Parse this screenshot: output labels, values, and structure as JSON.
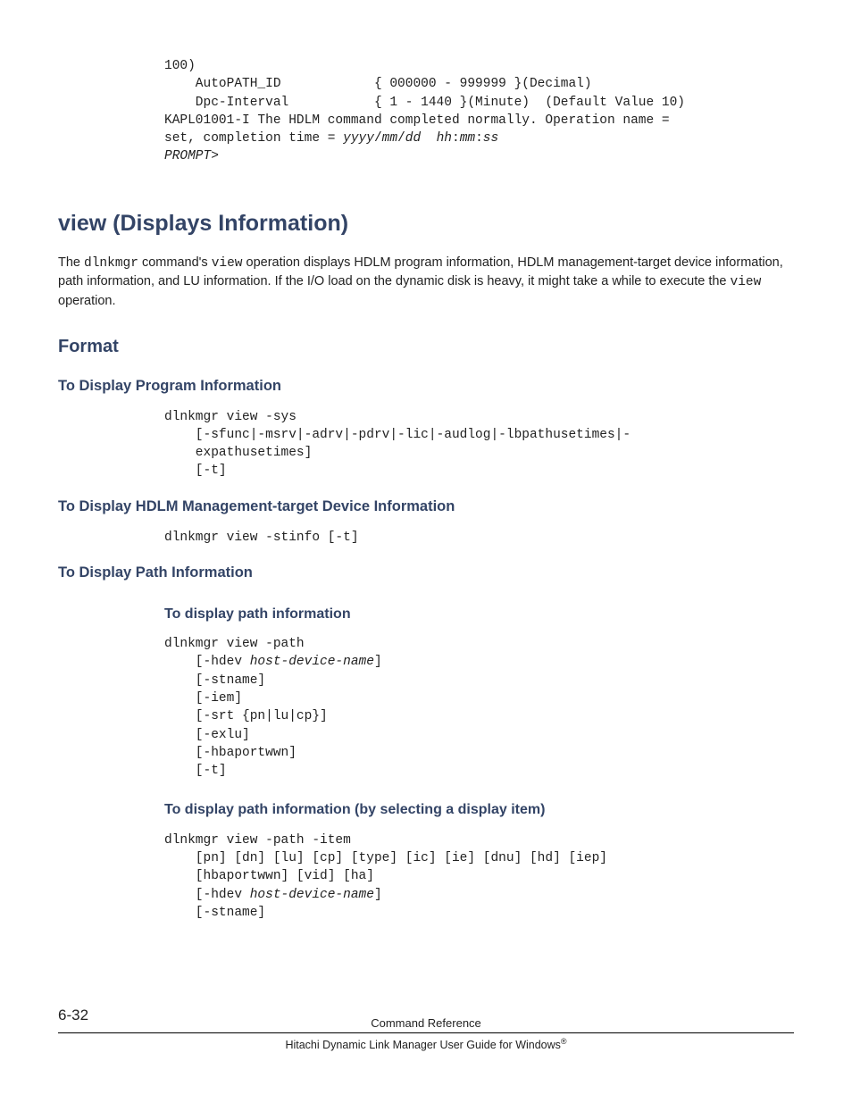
{
  "topcode": {
    "l1": "100)",
    "l2": "    AutoPATH_ID            { 000000 - 999999 }(Decimal)",
    "l3": "    Dpc-Interval           { 1 - 1440 }(Minute)  (Default Value 10)",
    "l4": "KAPL01001-I The HDLM command completed normally. Operation name = ",
    "l5": "set, completion time = ",
    "l5i": "yyyy",
    "l5s1": "/",
    "l5i2": "mm",
    "l5s2": "/",
    "l5i3": "dd",
    "l5sp": "  ",
    "l5i4": "hh",
    "l5s3": ":",
    "l5i5": "mm",
    "l5s4": ":",
    "l5i6": "ss",
    "l6": "PROMPT",
    "l6s": ">"
  },
  "h1": "view (Displays Information)",
  "intro": {
    "p1a": "The ",
    "p1b": "dlnkmgr",
    "p1c": " command's ",
    "p1d": "view",
    "p1e": " operation displays HDLM program information, HDLM management-target device information, path information, and LU information. If the I/O load on the dynamic disk is heavy, it might take a while to execute the ",
    "p1f": "view",
    "p1g": " operation."
  },
  "h2": "Format",
  "sec1": {
    "title": "To Display Program Information",
    "c1": "dlnkmgr view -sys",
    "c2": "    [-sfunc|-msrv|-adrv|-pdrv|-lic|-audlog|-lbpathusetimes|-",
    "c3": "    expathusetimes]",
    "c4": "    [-t]"
  },
  "sec2": {
    "title": "To Display HDLM Management-target Device Information",
    "c1": "dlnkmgr view -stinfo [-t]"
  },
  "sec3": {
    "title": "To Display Path Information",
    "sub1": {
      "title": "To display path information",
      "c1": "dlnkmgr view -path",
      "c2a": "    [-hdev ",
      "c2b": "host-device-name",
      "c2c": "]",
      "c3": "    [-stname]",
      "c4": "    [-iem]",
      "c5": "    [-srt {pn|lu|cp}]",
      "c6": "    [-exlu]",
      "c7": "    [-hbaportwwn]",
      "c8": "    [-t]"
    },
    "sub2": {
      "title": "To display path information (by selecting a display item)",
      "c1": "dlnkmgr view -path -item",
      "c2": "    [pn] [dn] [lu] [cp] [type] [ic] [ie] [dnu] [hd] [iep] ",
      "c3": "    [hbaportwwn] [vid] [ha]",
      "c4a": "    [-hdev ",
      "c4b": "host-device-name",
      "c4c": "]",
      "c5": "    [-stname]"
    }
  },
  "footer": {
    "page": "6-32",
    "title": "Command Reference",
    "sub": "Hitachi Dynamic Link Manager User Guide for Windows",
    "reg": "®"
  }
}
